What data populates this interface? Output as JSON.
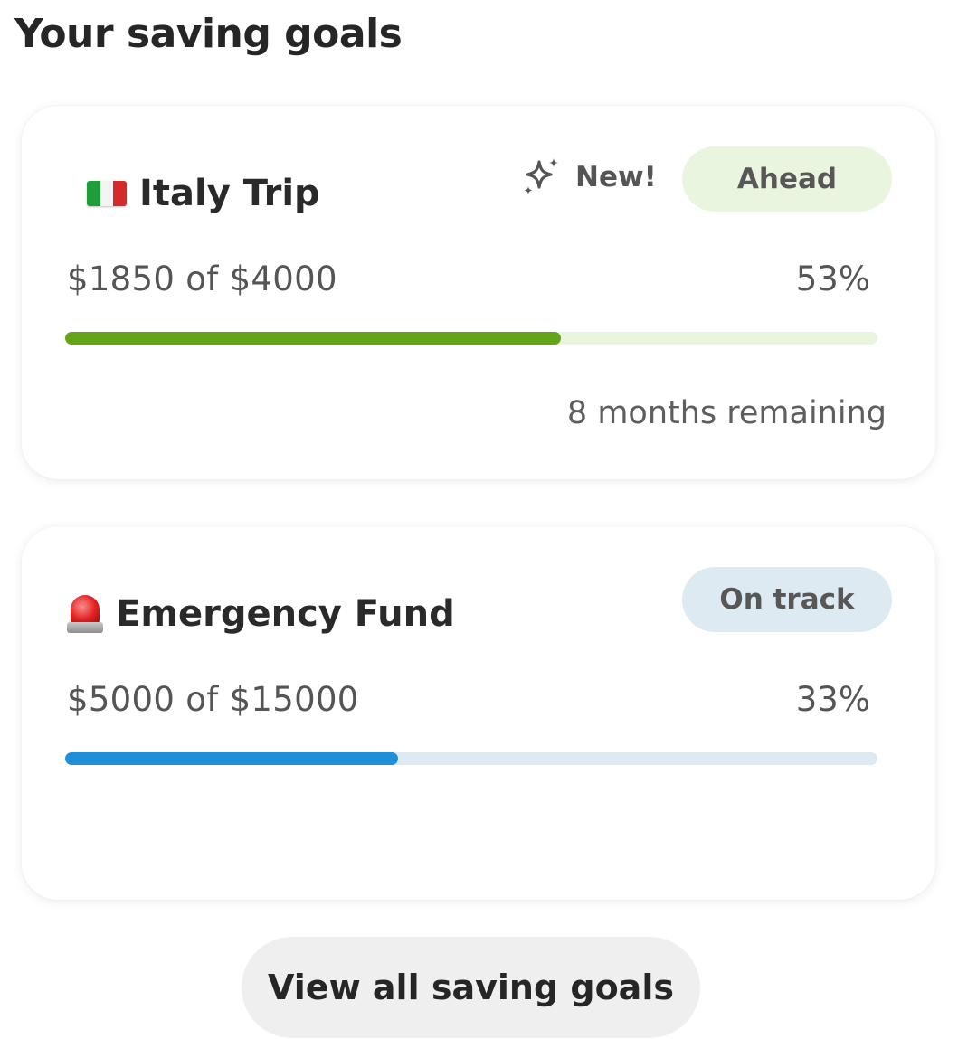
{
  "header": {
    "title": "Your saving goals"
  },
  "goals": [
    {
      "name": "Italy Trip",
      "icon": "italy-flag-icon",
      "new_label": "New!",
      "status": "Ahead",
      "amount_text": "$1850 of $4000",
      "percent_text": "53%",
      "progress": 0.61,
      "remaining_text": "8 months remaining",
      "accent_color": "#64a31a",
      "track_color": "#eaf5df"
    },
    {
      "name": "Emergency Fund",
      "icon": "rotating-light-icon",
      "status": "On track",
      "amount_text": "$5000 of $15000",
      "percent_text": "33%",
      "progress": 0.41,
      "accent_color": "#1f8fd8",
      "track_color": "#deeaf3"
    }
  ],
  "footer": {
    "view_all_label": "View all saving goals"
  }
}
